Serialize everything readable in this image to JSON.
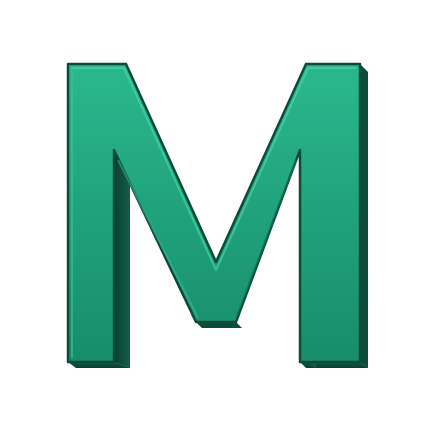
{
  "logo": {
    "letter": "M",
    "icon": "letter-m-logo-icon",
    "colors": {
      "background": "#ffffff",
      "face": "#1fa07a",
      "face_light": "#2bb88d",
      "face_dark": "#168a68",
      "side": "#0f5a45",
      "side_dark": "#0a3f31",
      "outline": "#0c4a39"
    }
  }
}
